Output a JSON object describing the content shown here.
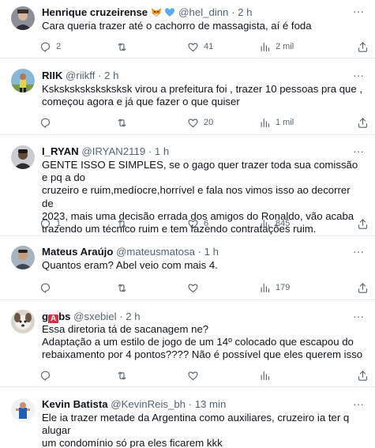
{
  "tweets": [
    {
      "display_name": "Henrique cruzeirense",
      "emojis": [
        "fox-emoji",
        "blue-heart-emoji"
      ],
      "handle": "@hel_dinn",
      "time": "· 2 h",
      "text": "Cara queria trazer até o cachorro de massagista, aí é foda",
      "replies": "2",
      "retweets": "",
      "likes": "41",
      "views": "2 mil"
    },
    {
      "display_name": "RIIK",
      "handle": "@riikff",
      "time": "· 2 h",
      "text": "Ksksksksksksksksk virou a prefeitura foi , trazer 10 pessoas pra que ,\ncomeçou agora e já que fazer o que quiser",
      "replies": "",
      "retweets": "",
      "likes": "20",
      "views": "1 mil"
    },
    {
      "display_name": "I_RYAN",
      "handle": "@IRYAN2119",
      "time": "· 1 h",
      "text": "GENTE ISSO E SIMPLES, se o gago quer trazer toda sua comissão e pq a do\ncruzeiro e ruim,medíocre,horrível e fala nos vimos isso ao decorrer de\n2023, mais uma decisão errada dos amigos do Ronaldo, vão acaba\ntrazendo um técnico ruim e tem fazendo contratações ruim.",
      "replies": "1",
      "retweets": "",
      "likes": "6",
      "views": "845"
    },
    {
      "display_name": "Mateus Araújo",
      "handle": "@mateusmatosa",
      "time": "· 1 h",
      "text": "Quantos eram? Abel veio com mais 4.",
      "replies": "",
      "retweets": "",
      "likes": "",
      "views": "179"
    },
    {
      "display_name_prefix": "g",
      "display_name_badge": "A",
      "display_name_suffix": "bs",
      "handle": "@sxebiel",
      "time": "· 2 h",
      "text": "Essa diretoria tá de sacanagem ne?\nAdaptação a um estilo de jogo de um 14º colocado que escapou do\nrebaixamento por 4 pontos???? Não é possível que eles querem isso",
      "replies": "",
      "retweets": "",
      "likes": "",
      "views": ""
    },
    {
      "display_name": "Kevin Batista",
      "handle": "@KevinReis_bh",
      "time": "· 13 min",
      "text": "Ele ia trazer metade da Argentina como auxiliares, cruzeiro ia ter q alugar\num condomínio só pra eles ficarem kkk"
    }
  ],
  "more_label": "···",
  "colors": {
    "text": "#0f1419",
    "secondary": "#536471",
    "divider": "#e6ecf0",
    "badge": "#dd2e44"
  }
}
